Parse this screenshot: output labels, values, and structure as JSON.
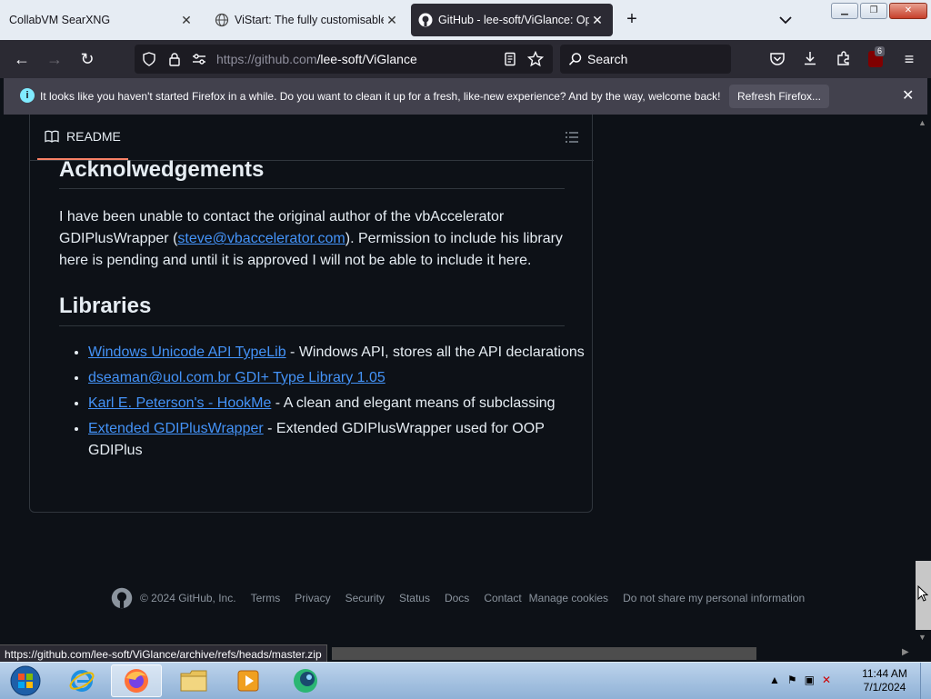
{
  "browser": {
    "tabs": [
      {
        "label": "CollabVM SearXNG"
      },
      {
        "label": "ViStart: The fully customisable"
      },
      {
        "label": "GitHub - lee-soft/ViGlance: Op"
      }
    ],
    "url_host": "https://github.com",
    "url_path": "/lee-soft/ViGlance",
    "search_placeholder": "Search",
    "extension_badge": "6"
  },
  "notification": {
    "message": "It looks like you haven't started Firefox in a while. Do you want to clean it up for a fresh, like-new experience? And by the way, welcome back!",
    "button": "Refresh Firefox..."
  },
  "readme": {
    "tab_label": "README",
    "ack_heading": "Acknolwedgements",
    "ack_text_before": "I have been unable to contact the original author of the vbAccelerator GDIPlusWrapper (",
    "ack_email": "steve@vbaccelerator.com",
    "ack_text_after": "). Permission to include his library here is pending and until it is approved I will not be able to include it here.",
    "libs_heading": "Libraries",
    "libraries": [
      {
        "link": "Windows Unicode API TypeLib",
        "desc": " - Windows API, stores all the API declarations"
      },
      {
        "link": "dseaman@uol.com.br GDI+ Type Library 1.05",
        "desc": ""
      },
      {
        "link": "Karl E. Peterson's - HookMe",
        "desc": " - A clean and elegant means of subclassing"
      },
      {
        "link": "Extended GDIPlusWrapper",
        "desc": " - Extended GDIPlusWrapper used for OOP GDIPlus"
      }
    ]
  },
  "footer": {
    "copyright": "© 2024 GitHub, Inc.",
    "links": [
      "Terms",
      "Privacy",
      "Security",
      "Status",
      "Docs",
      "Contact",
      "Manage cookies",
      "Do not share my personal information"
    ]
  },
  "status_url": "https://github.com/lee-soft/ViGlance/archive/refs/heads/master.zip",
  "taskbar": {
    "time": "11:44 AM",
    "date": "7/1/2024"
  }
}
